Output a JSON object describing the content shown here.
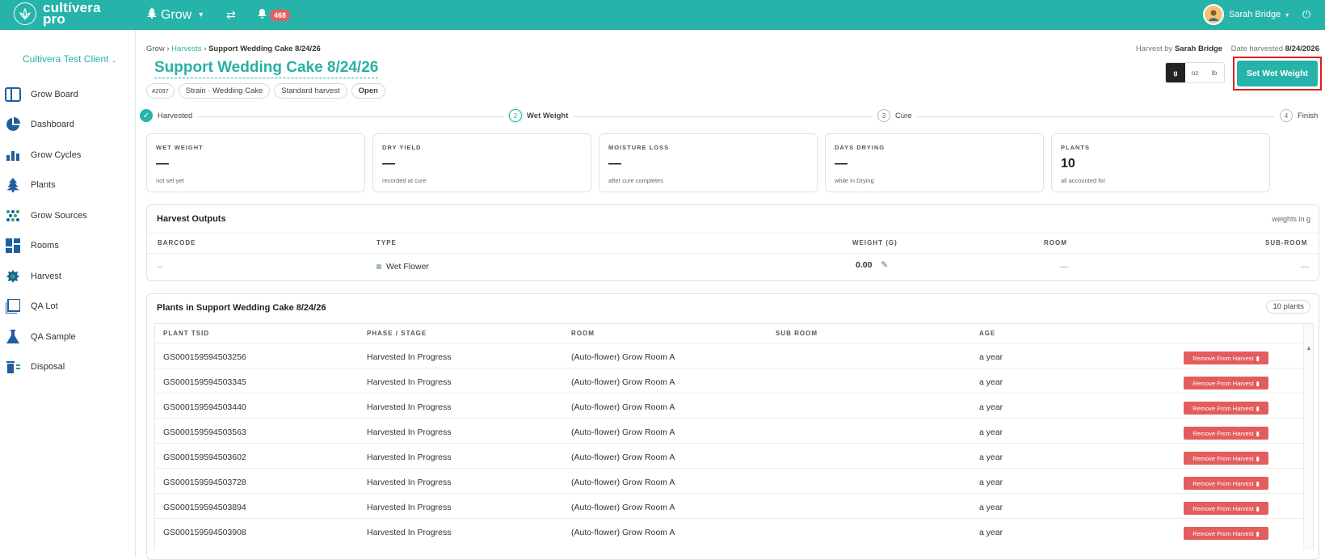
{
  "topbar": {
    "logo_line1": "cultívera",
    "logo_line2": "pro",
    "grow_label": "Grow",
    "notification_count": "468",
    "user_name": "Sarah Bridge"
  },
  "sidebar": {
    "client": "Cultivera Test Client",
    "items": [
      {
        "label": "Grow Board",
        "icon": "grow-board-icon"
      },
      {
        "label": "Dashboard",
        "icon": "pie-chart-icon"
      },
      {
        "label": "Grow Cycles",
        "icon": "bar-chart-icon"
      },
      {
        "label": "Plants",
        "icon": "tree-icon"
      },
      {
        "label": "Grow Sources",
        "icon": "seeds-icon"
      },
      {
        "label": "Rooms",
        "icon": "rooms-icon"
      },
      {
        "label": "Harvest",
        "icon": "harvest-icon"
      },
      {
        "label": "QA Lot",
        "icon": "qa-lot-icon"
      },
      {
        "label": "QA Sample",
        "icon": "flask-icon"
      },
      {
        "label": "Disposal",
        "icon": "trash-icon"
      }
    ]
  },
  "breadcrumb": {
    "root": "Grow",
    "sep1": "›",
    "mid": "Harvests",
    "sep2": "›",
    "current": "Support Wedding Cake 8/24/26"
  },
  "header": {
    "title": "Support Wedding Cake 8/24/26",
    "chips": [
      "#2097",
      "Strain · Wedding Cake",
      "Standard harvest",
      "Open"
    ],
    "harvest_by_label": "Harvest by",
    "harvest_by": "Sarah Bridge",
    "date_label": "Date harvested",
    "date": "8/24/2026"
  },
  "units": {
    "options": [
      "g",
      "oz",
      "lb"
    ],
    "selected": "g"
  },
  "primary_action": "Set Wet Weight",
  "steps": [
    {
      "num": "✓",
      "label": "Harvested",
      "state": "done"
    },
    {
      "num": "2",
      "label": "Wet Weight",
      "state": "current"
    },
    {
      "num": "3",
      "label": "Cure",
      "state": "pending"
    },
    {
      "num": "4",
      "label": "Finish",
      "state": "pending"
    }
  ],
  "kpis": [
    {
      "label": "WET WEIGHT",
      "value": "—",
      "note": "not set yet"
    },
    {
      "label": "DRY YIELD",
      "value": "—",
      "note": "recorded at cure"
    },
    {
      "label": "MOISTURE LOSS",
      "value": "—",
      "note": "after cure completes"
    },
    {
      "label": "DAYS DRYING",
      "value": "—",
      "note": "while in Drying"
    },
    {
      "label": "PLANTS",
      "value": "10",
      "note": "all accounted for"
    }
  ],
  "outputs": {
    "title": "Harvest Outputs",
    "right_note": "weights in g",
    "headers": [
      "BARCODE",
      "TYPE",
      "WEIGHT (G)",
      "ROOM",
      "SUB-ROOM"
    ],
    "row": {
      "barcode": "–",
      "type": "Wet Flower",
      "weight": "0.00",
      "room": "—",
      "subroom": "—"
    }
  },
  "plants": {
    "title": "Plants in Support Wedding Cake 8/24/26",
    "count_label": "10  plants",
    "headers": [
      "PLANT TSID",
      "PHASE / STAGE",
      "ROOM",
      "SUB ROOM",
      "AGE"
    ],
    "remove_label": "Remove From Harvest",
    "rows": [
      {
        "tsid": "GS000159594503256",
        "phase": "Harvested In Progress",
        "room": "(Auto-flower) Grow Room A",
        "subroom": "",
        "age": "a year"
      },
      {
        "tsid": "GS000159594503345",
        "phase": "Harvested In Progress",
        "room": "(Auto-flower) Grow Room A",
        "subroom": "",
        "age": "a year"
      },
      {
        "tsid": "GS000159594503440",
        "phase": "Harvested In Progress",
        "room": "(Auto-flower) Grow Room A",
        "subroom": "",
        "age": "a year"
      },
      {
        "tsid": "GS000159594503563",
        "phase": "Harvested In Progress",
        "room": "(Auto-flower) Grow Room A",
        "subroom": "",
        "age": "a year"
      },
      {
        "tsid": "GS000159594503602",
        "phase": "Harvested In Progress",
        "room": "(Auto-flower) Grow Room A",
        "subroom": "",
        "age": "a year"
      },
      {
        "tsid": "GS000159594503728",
        "phase": "Harvested In Progress",
        "room": "(Auto-flower) Grow Room A",
        "subroom": "",
        "age": "a year"
      },
      {
        "tsid": "GS000159594503894",
        "phase": "Harvested In Progress",
        "room": "(Auto-flower) Grow Room A",
        "subroom": "",
        "age": "a year"
      },
      {
        "tsid": "GS000159594503908",
        "phase": "Harvested In Progress",
        "room": "(Auto-flower) Grow Room A",
        "subroom": "",
        "age": "a year"
      }
    ]
  },
  "colors": {
    "brand": "#26b3a9",
    "danger": "#e35d5d",
    "badge": "#e85d5d"
  }
}
